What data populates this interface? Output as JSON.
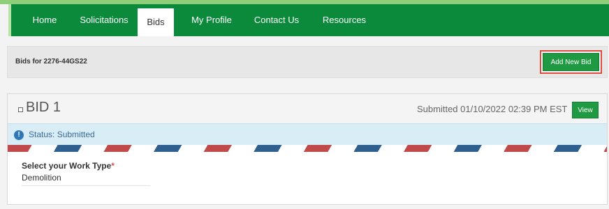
{
  "nav": {
    "items": [
      "Home",
      "Solicitations",
      "Bids",
      "My Profile",
      "Contact Us",
      "Resources"
    ],
    "active": "Bids"
  },
  "subbar": {
    "title": "Bids for 2276-44GS22",
    "add_button": "Add New Bid"
  },
  "bid": {
    "title": "BID 1",
    "submitted": "Submitted 01/10/2022 02:39 PM EST",
    "view_button": "View",
    "status": "Status: Submitted",
    "status_icon": "info-icon",
    "work_type_label": "Select your Work Type",
    "required_marker": "*",
    "work_type_value": "Demolition"
  },
  "colors": {
    "nav_green": "#0a8a3a",
    "button_green": "#1f9a43",
    "highlight_red": "#e04b3c",
    "status_bg": "#d9edf7"
  }
}
